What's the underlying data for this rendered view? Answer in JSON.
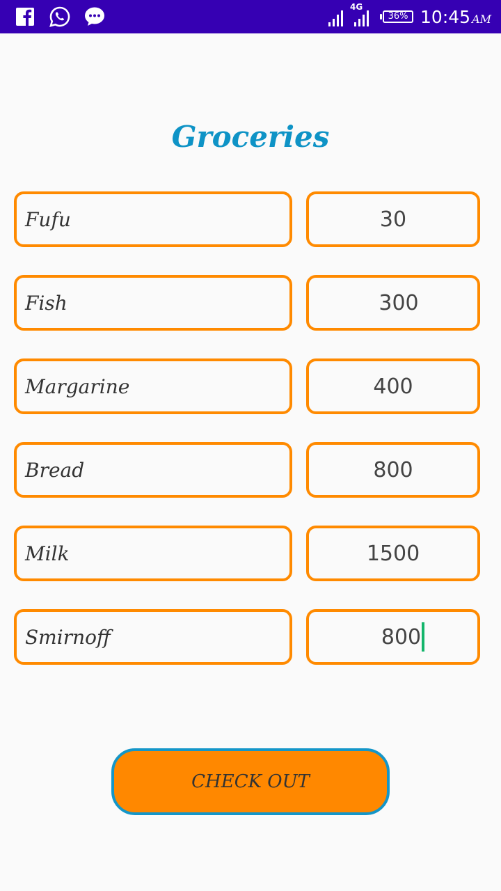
{
  "status_bar": {
    "network_type": "4G",
    "battery": "36%",
    "time": "10:45",
    "am_pm": "AM",
    "icons": [
      "facebook-icon",
      "whatsapp-icon",
      "messenger-icon",
      "signal-icon",
      "battery-icon"
    ],
    "background_color": "#3600b3"
  },
  "page": {
    "title": "Groceries",
    "title_color": "#0e93c6",
    "field_border_color": "#ff8a00"
  },
  "items": [
    {
      "name": "Fufu",
      "price": "30"
    },
    {
      "name": "Fish",
      "price": "300"
    },
    {
      "name": "Margarine",
      "price": "400"
    },
    {
      "name": "Bread",
      "price": "800"
    },
    {
      "name": "Milk",
      "price": "1500"
    },
    {
      "name": "Smirnoff",
      "price": "800"
    }
  ],
  "checkout": {
    "label": "CHECK OUT",
    "background_color": "#ff8800",
    "border_color": "#1496c8"
  }
}
